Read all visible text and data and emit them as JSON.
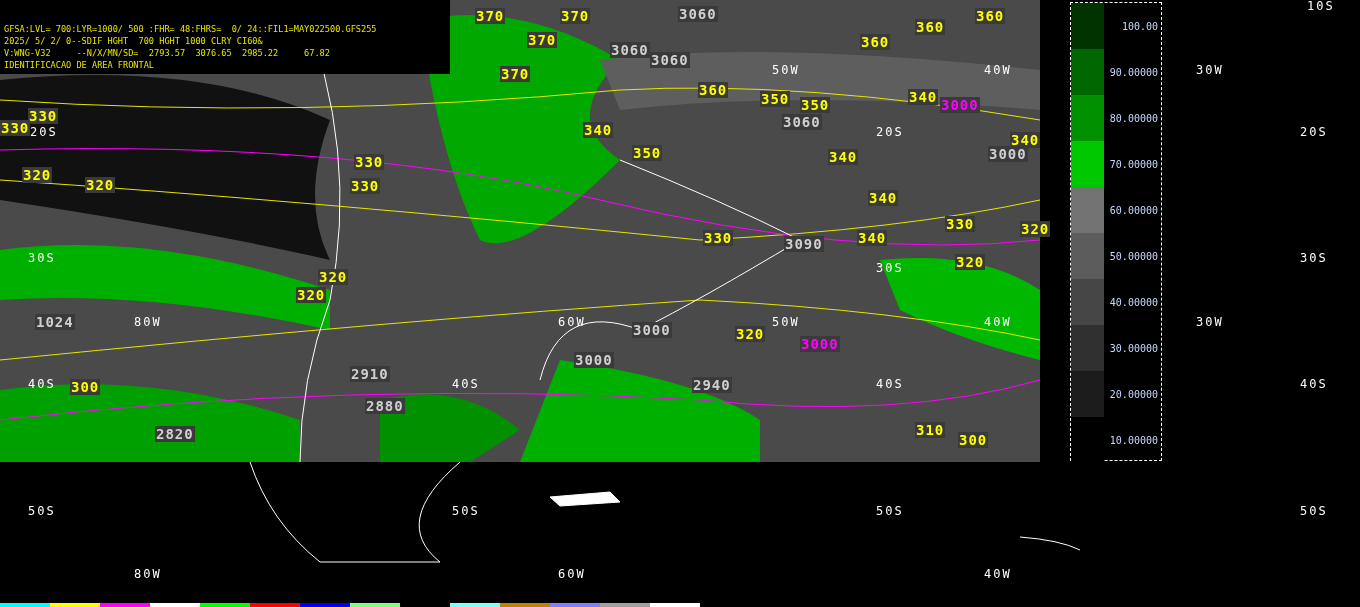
{
  "header": {
    "lines": [
      "GFSA:LVL= 700:LYR=1000/ 500 :FHR= 48:FHRS=  0/ 24::FIL1=MAY022500.GFS255",
      "2025/ 5/ 2/ 0--SDIF HGHT  700 HGHT 1000 CLRY CI60&",
      "V:WNG-V32     --N/X/MN/SD=  2793.57  3076.65  2985.22     67.82"
    ],
    "title": "IDENTIFICACAO DE AREA FRONTAL"
  },
  "contour_labels": [
    {
      "text": "370",
      "kind": "thickness"
    },
    {
      "text": "370",
      "kind": "thickness"
    },
    {
      "text": "370",
      "kind": "thickness"
    },
    {
      "text": "370",
      "kind": "thickness"
    },
    {
      "text": "360",
      "kind": "thickness"
    },
    {
      "text": "360",
      "kind": "thickness"
    },
    {
      "text": "360",
      "kind": "thickness"
    },
    {
      "text": "360",
      "kind": "thickness"
    },
    {
      "text": "350",
      "kind": "thickness"
    },
    {
      "text": "350",
      "kind": "thickness"
    },
    {
      "text": "350",
      "kind": "thickness"
    },
    {
      "text": "340",
      "kind": "thickness"
    },
    {
      "text": "340",
      "kind": "thickness"
    },
    {
      "text": "340",
      "kind": "thickness"
    },
    {
      "text": "340",
      "kind": "thickness"
    },
    {
      "text": "340",
      "kind": "thickness"
    },
    {
      "text": "340",
      "kind": "thickness"
    },
    {
      "text": "330",
      "kind": "thickness"
    },
    {
      "text": "330",
      "kind": "thickness"
    },
    {
      "text": "330",
      "kind": "thickness"
    },
    {
      "text": "330",
      "kind": "thickness"
    },
    {
      "text": "330",
      "kind": "thickness"
    },
    {
      "text": "330",
      "kind": "thickness"
    },
    {
      "text": "320",
      "kind": "thickness"
    },
    {
      "text": "320",
      "kind": "thickness"
    },
    {
      "text": "320",
      "kind": "thickness"
    },
    {
      "text": "320",
      "kind": "thickness"
    },
    {
      "text": "320",
      "kind": "thickness"
    },
    {
      "text": "320",
      "kind": "thickness"
    },
    {
      "text": "320",
      "kind": "thickness"
    },
    {
      "text": "310",
      "kind": "thickness"
    },
    {
      "text": "300",
      "kind": "thickness"
    },
    {
      "text": "300",
      "kind": "thickness"
    },
    {
      "text": "3060",
      "kind": "height"
    },
    {
      "text": "3060",
      "kind": "height"
    },
    {
      "text": "3060",
      "kind": "height"
    },
    {
      "text": "3060",
      "kind": "height"
    },
    {
      "text": "3000",
      "kind": "height"
    },
    {
      "text": "3000",
      "kind": "height"
    },
    {
      "text": "3000",
      "kind": "height"
    },
    {
      "text": "2940",
      "kind": "height"
    },
    {
      "text": "2880",
      "kind": "height"
    },
    {
      "text": "2820",
      "kind": "height"
    },
    {
      "text": "2910",
      "kind": "height"
    },
    {
      "text": "3090",
      "kind": "height"
    },
    {
      "text": "1024",
      "kind": "height"
    },
    {
      "text": "3000",
      "kind": "frontal"
    },
    {
      "text": "3000",
      "kind": "frontal"
    }
  ],
  "grid_labels": [
    "10S",
    "20S",
    "20S",
    "20S",
    "30S",
    "30S",
    "30S",
    "40S",
    "40S",
    "40S",
    "40S",
    "50S",
    "50S",
    "50S",
    "50S",
    "80W",
    "80W",
    "60W",
    "60W",
    "50W",
    "50W",
    "40W",
    "40W",
    "40W",
    "30W",
    "30W"
  ],
  "legend": [
    {
      "label": "100.00",
      "color": "#003300"
    },
    {
      "label": "90.00000",
      "color": "#006600"
    },
    {
      "label": "80.00000",
      "color": "#009000"
    },
    {
      "label": "70.00000",
      "color": "#00c800"
    },
    {
      "label": "60.00000",
      "color": "#727272"
    },
    {
      "label": "50.00000",
      "color": "#5c5c5c"
    },
    {
      "label": "40.00000",
      "color": "#464646"
    },
    {
      "label": "30.00000",
      "color": "#303030"
    },
    {
      "label": "20.00000",
      "color": "#1c1c1c"
    },
    {
      "label": "10.00000",
      "color": "#000000"
    }
  ]
}
